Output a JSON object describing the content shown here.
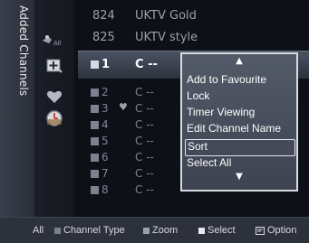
{
  "side_tab": {
    "label": "Added Channels"
  },
  "side_icons": [
    "all-channels-icon",
    "add-channel-icon",
    "favourite-heart-icon",
    "timer-icon"
  ],
  "side_icon_labels": {
    "all": "All"
  },
  "top_channels": [
    {
      "num": "824",
      "name": "UKTV Gold"
    },
    {
      "num": "825",
      "name": "UKTV style"
    }
  ],
  "channels": [
    {
      "num": "1",
      "name": "C --",
      "selected": true,
      "favourite": false
    },
    {
      "num": "2",
      "name": "C --",
      "selected": false,
      "favourite": false
    },
    {
      "num": "3",
      "name": "C --",
      "selected": false,
      "favourite": true
    },
    {
      "num": "4",
      "name": "C --",
      "selected": false,
      "favourite": false
    },
    {
      "num": "5",
      "name": "C --",
      "selected": false,
      "favourite": false
    },
    {
      "num": "6",
      "name": "C --",
      "selected": false,
      "favourite": false
    },
    {
      "num": "7",
      "name": "C --",
      "selected": false,
      "favourite": false
    },
    {
      "num": "8",
      "name": "C --",
      "selected": false,
      "favourite": false
    }
  ],
  "popup": {
    "items": [
      "Add to Favourite",
      "Lock",
      "Timer Viewing",
      "Edit Channel Name",
      "Sort",
      "Select All"
    ],
    "focused_index": 4
  },
  "bottom_bar": {
    "all": "All",
    "channel_type": "Channel Type",
    "zoom": "Zoom",
    "select": "Select",
    "option": "Option"
  },
  "colors": {
    "accent_frame": "#d9dbe0",
    "popup_bg": "#4a505d",
    "background": "#0d1016"
  }
}
